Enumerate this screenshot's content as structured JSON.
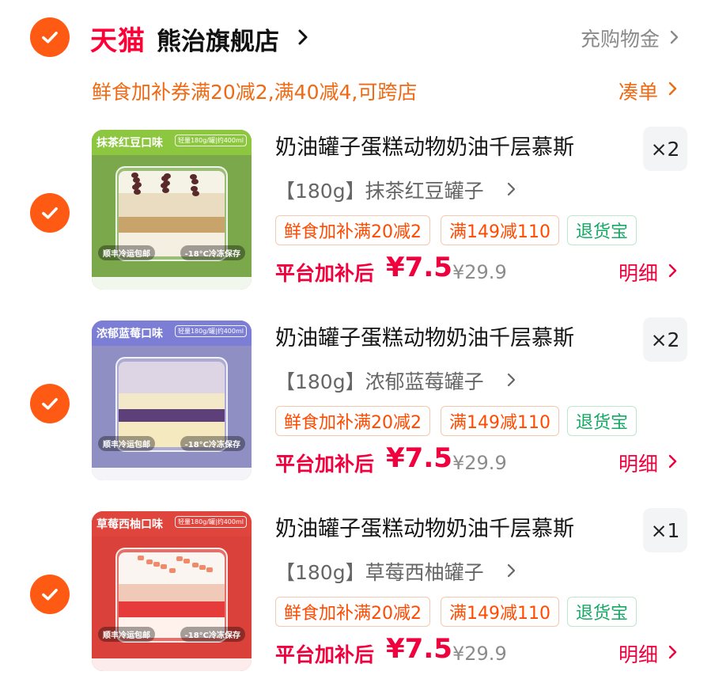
{
  "store": {
    "platform": "天猫",
    "name": "熊治旗舰店",
    "top_up_label": "充购物金",
    "coupon_text": "鲜食加补券满20减2,满40减4,可跨店",
    "combine_label": "凑单"
  },
  "colors": {
    "accent": "#ff5a13",
    "price": "#f0003c",
    "coupon": "#ee6a14",
    "green": "#17a866"
  },
  "items": [
    {
      "title": "奶油罐子蛋糕动物奶油千层慕斯",
      "quantity": "×2",
      "variant": "【180g】抹茶红豆罐子",
      "tags": [
        "鲜食加补满20减2",
        "满149减110",
        "退货宝"
      ],
      "price_prefix": "平台加补后",
      "price": "¥7.5",
      "original_price": "¥29.9",
      "detail_label": "明细",
      "thumb": {
        "flavor": "抹茶红豆口味",
        "weight": "轻量180g/罐|约400ml",
        "shipping": "顺丰冷运包邮",
        "storage": "-18°C冷冻保存",
        "band_color": "#8dc63f",
        "bg_color": "#7aa84a",
        "layer_color": "#c9a46a"
      }
    },
    {
      "title": "奶油罐子蛋糕动物奶油千层慕斯",
      "quantity": "×2",
      "variant": "【180g】浓郁蓝莓罐子",
      "tags": [
        "鲜食加补满20减2",
        "满149减110",
        "退货宝"
      ],
      "price_prefix": "平台加补后",
      "price": "¥7.5",
      "original_price": "¥29.9",
      "detail_label": "明细",
      "thumb": {
        "flavor": "浓郁蓝莓口味",
        "weight": "轻量180g/罐|约400ml",
        "shipping": "顺丰冷运包邮",
        "storage": "-18°C冷冻保存",
        "band_color": "#7c7ed6",
        "bg_color": "#8f8fc4",
        "layer_color": "#5d3f7a"
      }
    },
    {
      "title": "奶油罐子蛋糕动物奶油千层慕斯",
      "quantity": "×1",
      "variant": "【180g】草莓西柚罐子",
      "tags": [
        "鲜食加补满20减2",
        "满149减110",
        "退货宝"
      ],
      "price_prefix": "平台加补后",
      "price": "¥7.5",
      "original_price": "¥29.9",
      "detail_label": "明细",
      "thumb": {
        "flavor": "草莓西柚口味",
        "weight": "轻量180g/罐|约400ml",
        "shipping": "顺丰冷运包邮",
        "storage": "-18°C冷冻保存",
        "band_color": "#e0453d",
        "bg_color": "#d9413a",
        "layer_color": "#e63b3b"
      }
    }
  ]
}
